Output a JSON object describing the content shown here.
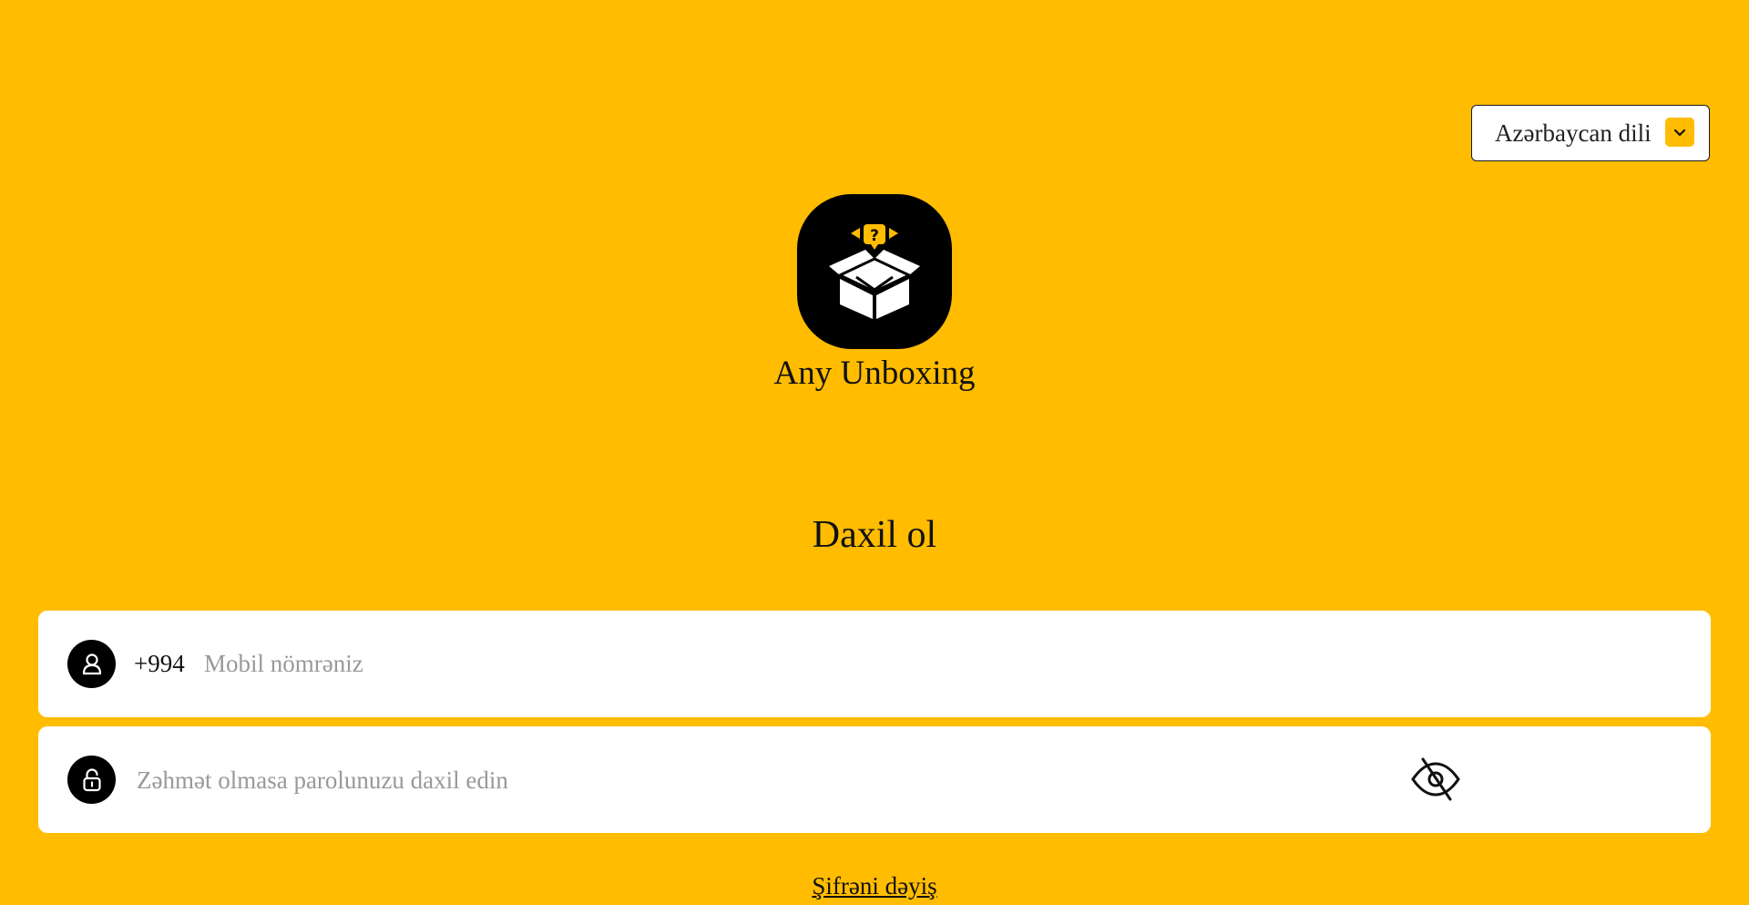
{
  "language_select": {
    "selected": "Azərbaycan dili",
    "icon": "chevron-down-icon"
  },
  "brand": {
    "name": "Any Unboxing",
    "logo_icon": "open-box-question-icon"
  },
  "login": {
    "title": "Daxil ol",
    "phone": {
      "prefix": "+994",
      "placeholder": "Mobil nömrəniz",
      "value": "",
      "icon": "user-icon"
    },
    "password": {
      "placeholder": "Zəhmət olmasa parolunuzu daxil edin",
      "value": "",
      "icon": "lock-icon",
      "toggle_icon": "eye-off-icon"
    },
    "forgot_link": "Şifrəni dəyiş"
  },
  "colors": {
    "background": "#FFBC00",
    "field_background": "#FFFFFF",
    "icon_background": "#000000"
  }
}
